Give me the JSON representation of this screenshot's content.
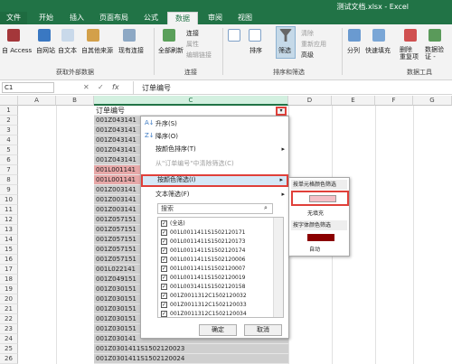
{
  "window": {
    "title": "测试文档.xlsx - Excel"
  },
  "tabs": [
    "文件",
    "开始",
    "插入",
    "页面布局",
    "公式",
    "数据",
    "审阅",
    "视图"
  ],
  "ribbon": {
    "get_external": {
      "access": "自 Access",
      "web": "自网站",
      "text": "自文本",
      "other": "自其他来源",
      "existing": "现有连接",
      "group": "获取外部数据"
    },
    "connections": {
      "refresh_all": "全部刷新",
      "connections": "连接",
      "properties": "属性",
      "edit_links": "编辑链接",
      "group": "连接"
    },
    "sort_filter": {
      "sort": "排序",
      "filter": "筛选",
      "clear": "清除",
      "reapply": "重新应用",
      "advanced": "高级",
      "group": "排序和筛选"
    },
    "data_tools": {
      "split": "分列",
      "flash_fill": "快速填充",
      "remove_dup": "删除\n重复项",
      "validate": "数据验\n证 -",
      "group": "数据工具"
    }
  },
  "formula_bar": {
    "name_box": "C1",
    "content": "订单编号",
    "fx": "fx"
  },
  "columns": [
    "A",
    "B",
    "C",
    "D",
    "E",
    "F",
    "G"
  ],
  "rows": [
    "1",
    "2",
    "3",
    "4",
    "5",
    "6",
    "7",
    "8",
    "9",
    "10",
    "11",
    "12",
    "13",
    "14",
    "15",
    "16",
    "17",
    "18",
    "19",
    "20",
    "21",
    "22",
    "23",
    "24",
    "25",
    "26"
  ],
  "cells": [
    "订单编号",
    "001Z043141",
    "001Z043141",
    "001Z043141",
    "001Z043141",
    "001Z043141",
    "001L001141",
    "001L001141",
    "001Z003141",
    "001Z003141",
    "001Z003141",
    "001Z057151",
    "001Z057151",
    "001Z057151",
    "001Z057151",
    "001Z057151",
    "001L022141",
    "001Z049151",
    "001Z030151",
    "001Z030151",
    "001Z030151",
    "001Z030151",
    "001Z030151",
    "001Z030141",
    "001Z0301411S1502120023",
    "001Z0301411S1502120024"
  ],
  "menu": {
    "sort_asc": "升序(S)",
    "sort_desc": "降序(O)",
    "sort_color": "按颜色排序(T)",
    "clear_filter": "从\"订单编号\"中清除筛选(C)",
    "filter_color": "按颜色筛选(I)",
    "text_filter": "文本筛选(F)",
    "search_placeholder": "搜索",
    "select_all": "(全选)",
    "items": [
      "001L0011411S1502120171",
      "001L0011411S1502120173",
      "001L0011411S1502120174",
      "001L0011411S1502120006",
      "001L0011411S1502120007",
      "001L0011411S1502120019",
      "001L0031411S1502120158",
      "001Z0011312C1502120032",
      "001Z0011312C1502120033",
      "001Z0011312C1502120034",
      "001Z0011312C1502120035",
      "001Z0011312C1502120036"
    ],
    "ok": "确定",
    "cancel": "取消"
  },
  "submenu": {
    "cell_color_title": "按单元格颜色筛选",
    "no_fill": "无填充",
    "font_color_title": "按字体颜色筛选",
    "auto": "自动",
    "pink": "#f4c0c8",
    "darkred": "#8b0000"
  },
  "colors": {
    "brand": "#217346",
    "highlight": "#e0403a",
    "pink_row": "#e7a8a8"
  }
}
